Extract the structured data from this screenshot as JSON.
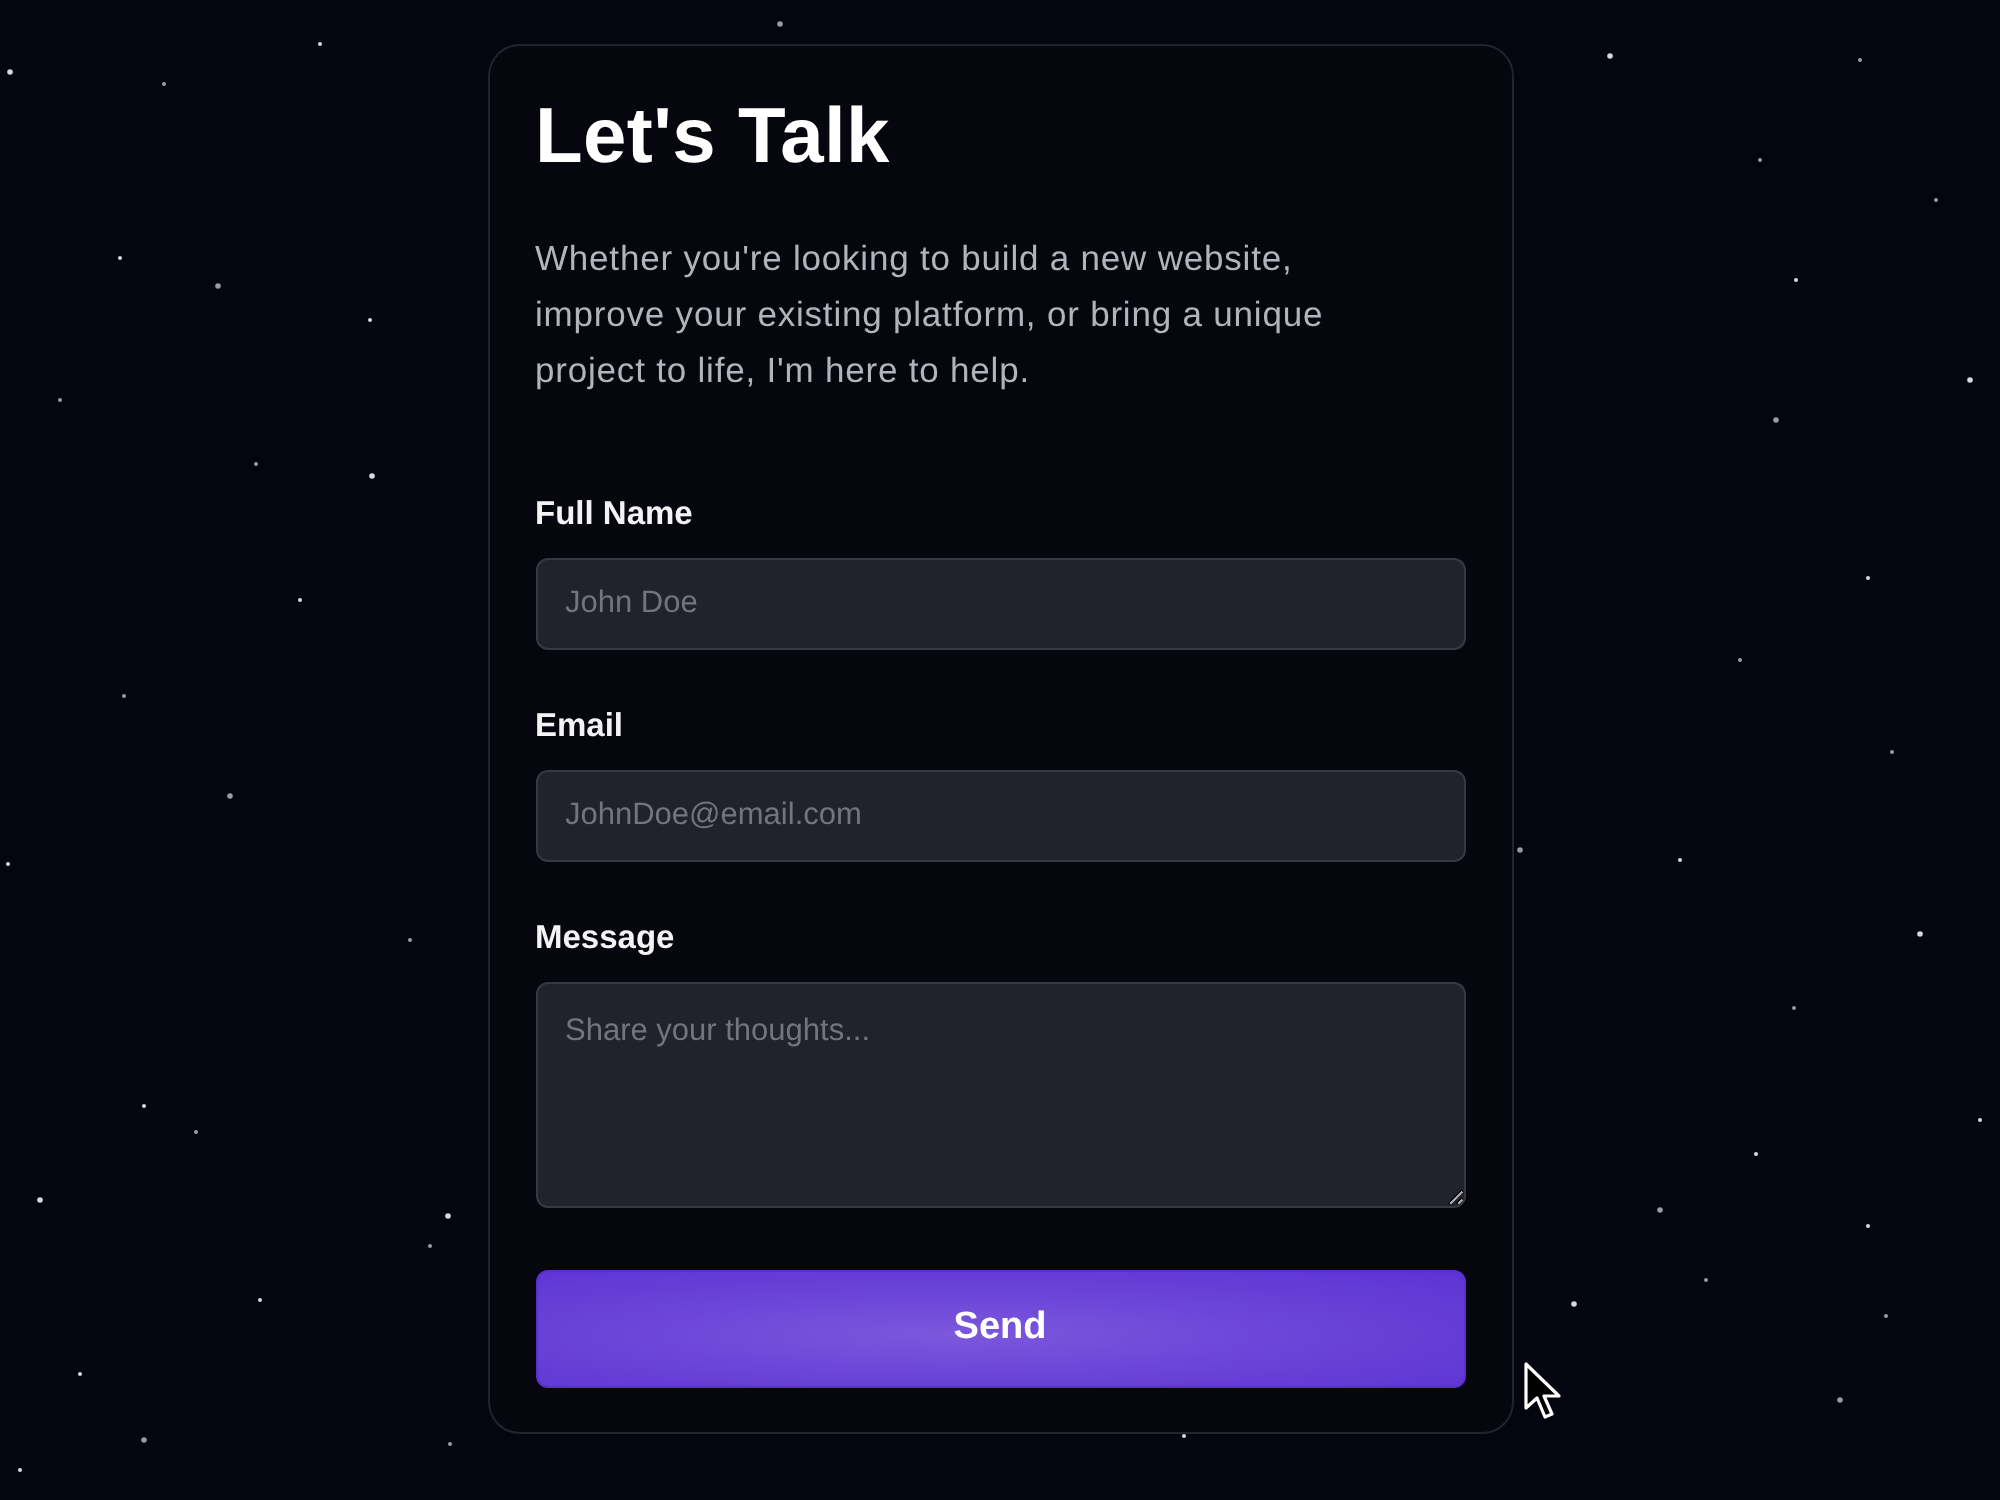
{
  "title": "Let's Talk",
  "intro": "Whether you're looking to build a new website, improve your existing platform, or bring a unique project to life, I'm here to help.",
  "fields": [
    {
      "kind": "input",
      "label": "Full Name",
      "placeholder": "John Doe"
    },
    {
      "kind": "input",
      "label": "Email",
      "placeholder": "JohnDoe@email.com"
    },
    {
      "kind": "textarea",
      "label": "Message",
      "placeholder": "Share your thoughts..."
    }
  ],
  "submit": {
    "label": "Send"
  }
}
